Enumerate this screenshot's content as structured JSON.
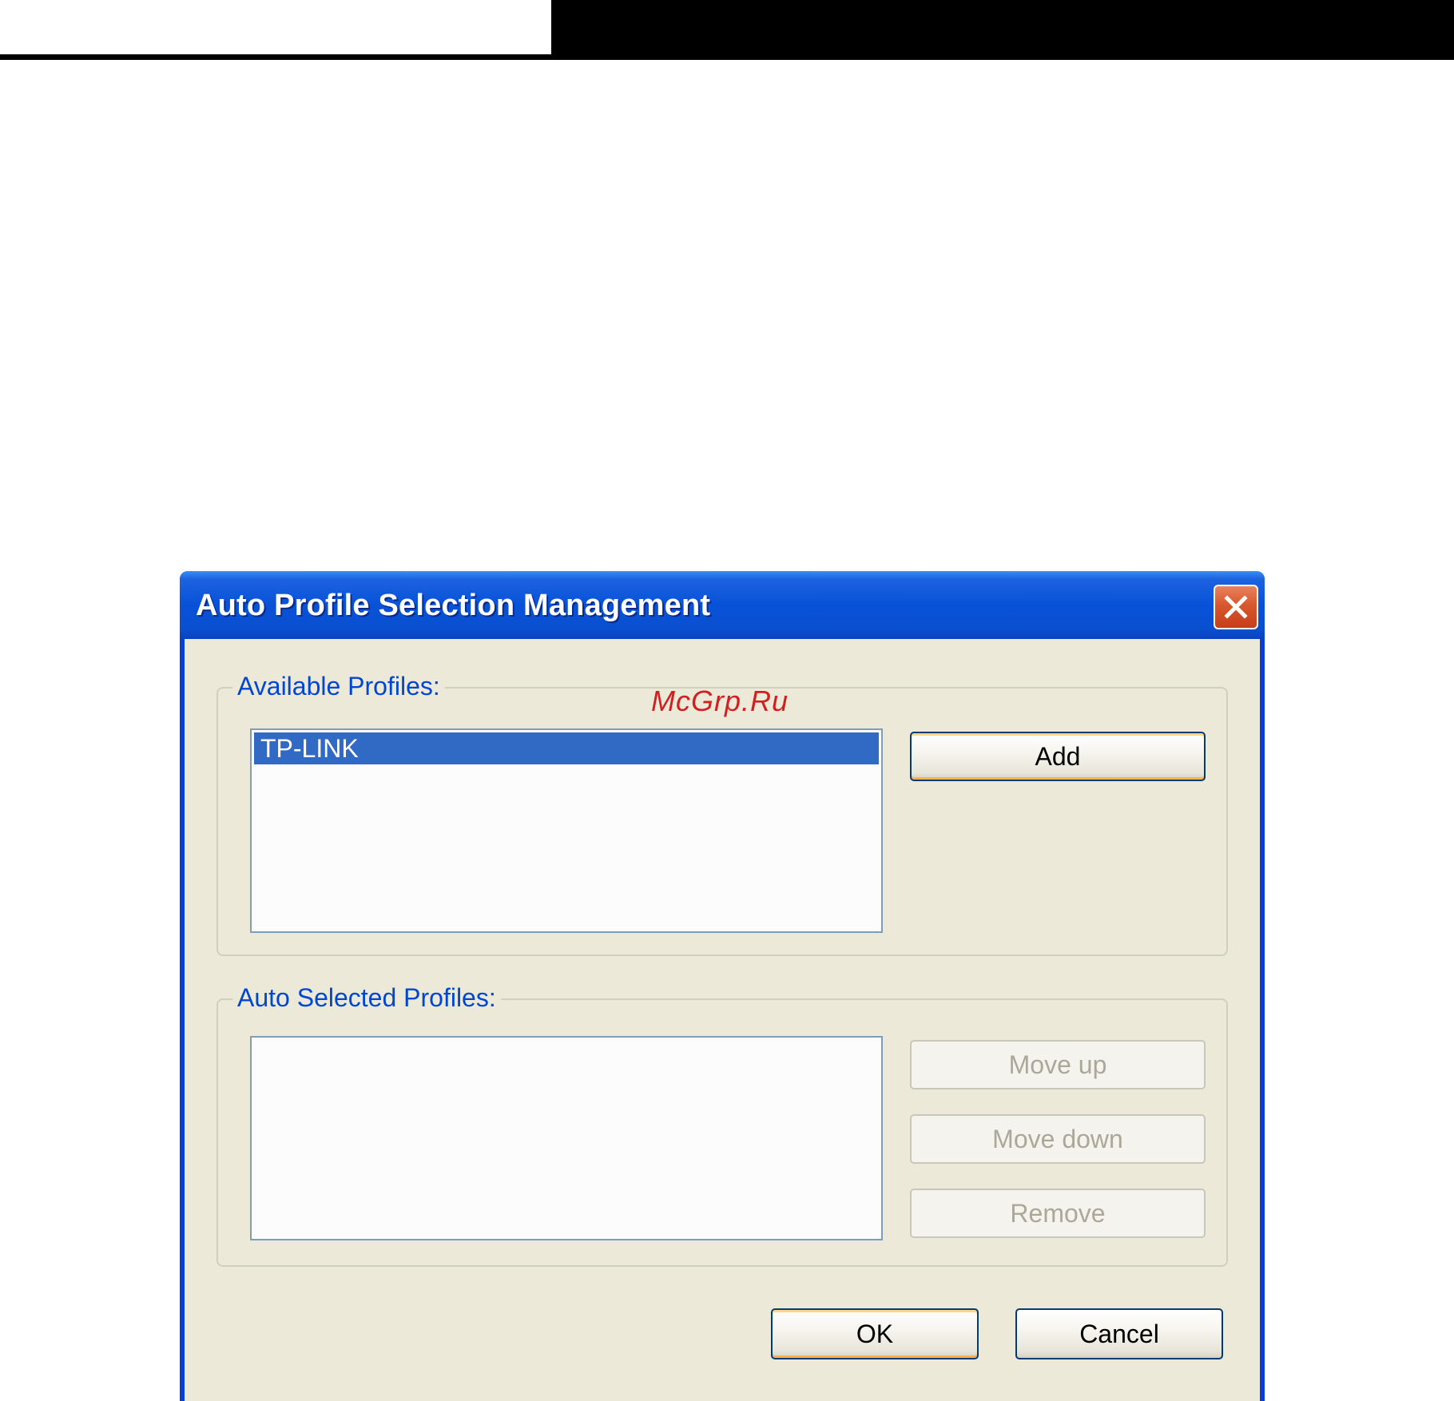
{
  "dialog": {
    "title": "Auto Profile Selection Management"
  },
  "available": {
    "label": "Available Profiles:",
    "items": [
      "TP-LINK"
    ],
    "add_label": "Add"
  },
  "auto_selected": {
    "label": "Auto Selected Profiles:",
    "move_up_label": "Move up",
    "move_down_label": "Move down",
    "remove_label": "Remove"
  },
  "footer": {
    "ok_label": "OK",
    "cancel_label": "Cancel"
  },
  "watermark": "McGrp.Ru",
  "colors": {
    "titlebar": "#0852D8",
    "client_bg": "#ECE9D8",
    "selection": "#316AC5",
    "group_label": "#0046D5",
    "close_button": "#D8582D"
  }
}
